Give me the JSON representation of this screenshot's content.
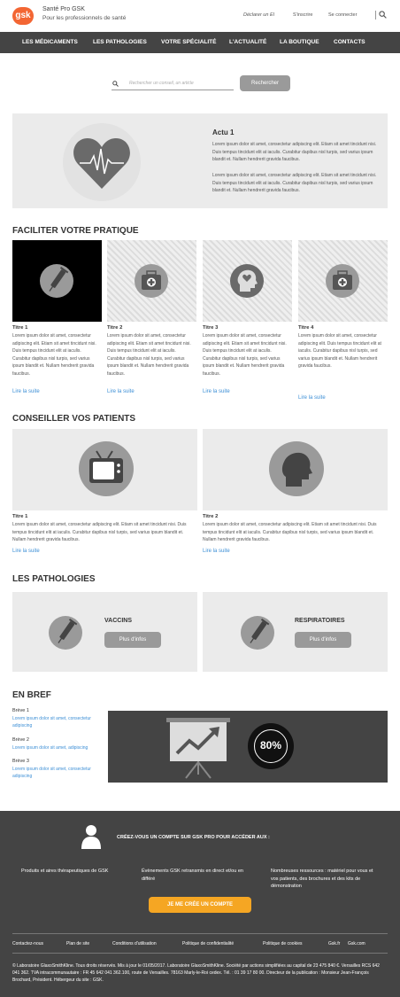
{
  "header": {
    "logo": "gsk",
    "brand_title": "Santé Pro GSK",
    "brand_subtitle": "Pour les professionnels de santé",
    "declare": "Déclarer un EI",
    "signup": "S'inscrire",
    "login": "Se connecter"
  },
  "nav": [
    "LES MÉDICAMENTS",
    "LES PATHOLOGIES",
    "VOTRE SPÉCIALITÉ",
    "L'ACTUALITÉ",
    "LA BOUTIQUE",
    "CONTACTS"
  ],
  "search": {
    "placeholder": "Rechercher un conseil, un article",
    "button": "Rechercher"
  },
  "hero": {
    "title": "Actu 1",
    "p1": "Lorem ipsum dolor sit amet, consectetur adipiscing elit. Etiam sit amet tincidunt nisi. Duis tempus tincidunt elit at iaculis. Curabitur dapibus nisl turpis, sed varius ipsum blandit et. Nullam hendrerit gravida faucibus.",
    "p2": "Lorem ipsum dolor sit amet, consectetur adipiscing elit. Etiam sit amet tincidunt nisi. Duis tempus tincidunt elit at iaculis. Curabitur dapibus nisl turpis, sed varius ipsum blandit et. Nullam hendrerit gravida faucibus."
  },
  "pratique": {
    "heading": "FACILITER VOTRE PRATIQUE",
    "cards": [
      {
        "title": "Titre 1",
        "text": "Lorem ipsum dolor sit amet, consectetur adipiscing elit. Etiam sit amet tincidunt nisi. Duis tempus tincidunt elit at iaculis. Curabitur dapibus nisl turpis, sed varius ipsum blandit et. Nullam hendrerit gravida faucibus.",
        "link": "Lire la suite"
      },
      {
        "title": "Titre 2",
        "text": "Lorem ipsum dolor sit amet, consectetur adipiscing elit. Etiam sit amet tincidunt nisi. Duis tempus tincidunt elit at iaculis. Curabitur dapibus nisl turpis, sed varius ipsum blandit et. Nullam hendrerit gravida faucibus.",
        "link": "Lire la suite"
      },
      {
        "title": "Titre 3",
        "text": "Lorem ipsum dolor sit amet, consectetur adipiscing elit. Etiam sit amet tincidunt nisi. Duis tempus tincidunt elit at iaculis. Curabitur dapibus nisl turpis, sed varius ipsum blandit et. Nullam hendrerit gravida faucibus.",
        "link": "Lire la suite"
      },
      {
        "title": "Titre 4",
        "text": "Lorem ipsum dolor sit amet, consectetur adipiscing elit. Duis tempus tincidunt elit at iaculis. Curabitur dapibus nisl turpis, sed varius ipsum blandit et. Nullam hendrerit gravida faucibus.",
        "link": "Lire la suite"
      }
    ]
  },
  "patients": {
    "heading": "CONSEILLER VOS PATIENTS",
    "cards": [
      {
        "title": "Titre 1",
        "text": "Lorem ipsum dolor sit amet, consectetur adipiscing elit. Etiam sit amet tincidunt nisi. Duis tempus tincidunt elit at iaculis. Curabitur dapibus nisl turpis, sed varius ipsum blandit et. Nullam hendrerit gravida faucibus.",
        "link": "Lire la suite"
      },
      {
        "title": "Titre 2",
        "text": "Lorem ipsum dolor sit amet, consectetur adipiscing elit. Etiam sit amet tincidunt nisi. Duis tempus tincidunt elit at iaculis. Curabitur dapibus nisl turpis, sed varius ipsum blandit et. Nullam hendrerit gravida faucibus.",
        "link": "Lire la suite"
      }
    ]
  },
  "pathologies": {
    "heading": "LES PATHOLOGIES",
    "items": [
      {
        "label": "VACCINS",
        "button": "Plus d'infos"
      },
      {
        "label": "RESPIRATOIRES",
        "button": "Plus d'infos"
      }
    ]
  },
  "bref": {
    "heading": "EN BREF",
    "items": [
      {
        "title": "Brève 1",
        "text": "Lorem ipsum dolor sit amet, consectetur adipiscing"
      },
      {
        "title": "Brève 2",
        "text": "Lorem ipsum dolor sit amet, adipiscing"
      },
      {
        "title": "Brève 3",
        "text": "Lorem ipsum dolor sit amet, consectetur adipiscing"
      }
    ],
    "stat": "80%"
  },
  "footer": {
    "cta_title": "CRÉEZ-VOUS UN COMPTE SUR GSK PRO POUR ACCÉDER AUX :",
    "col1": "Produits et aires thérapeutiques de GSK",
    "col2": "Évènements GSK retransmis en direct et/ou en différé",
    "col3": "Nombreuses ressources : matériel pour vous et vos patients, des brochures et des kits de démonstration",
    "cta_button": "JE ME CRÉE UN COMPTE",
    "links": [
      "Contactez-nous",
      "Plan de site",
      "Conditions d'utilisation",
      "Politique de confidentialité",
      "Politique de cookies",
      "Gsk.fr",
      "Gsk.com"
    ],
    "legal": "© Laboratoire GlaxoSmithKline. Tous droits réservés. Mis à jour le 01/05/2017. Laboratoire GlaxoSmithKline. Société par actions simplifiées au capital de 23 475 840 €. Versailles RCS 642 041 362. TVA intracommunautaire : FR 45 642 041 362.100, route de Versailles. 78163 Marly-le-Roi cedex. Tél. : 01 39 17 80 00. Directeur de la publication : Monsieur Jean-François Brochard, Président. Hébergeur du site : GSK."
  },
  "colors": {
    "accent": "#f36633",
    "nav": "#444444",
    "link": "#3d8fd6",
    "cta": "#f5a623"
  },
  "icons": [
    "search-icon",
    "heart-icon",
    "syringe-icon",
    "first-aid-kit-icon",
    "head-icon",
    "tv-icon",
    "presentation-chart-icon",
    "user-icon"
  ]
}
